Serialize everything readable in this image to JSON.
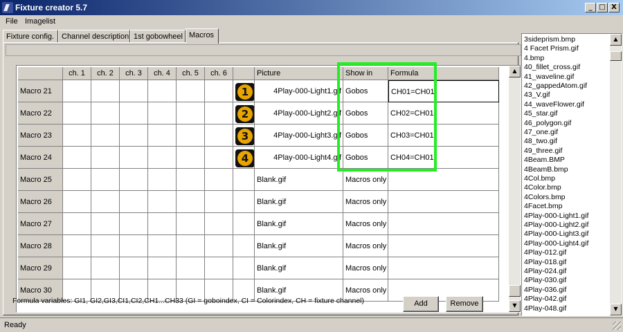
{
  "window": {
    "title": "Fixture creator 5.7",
    "min": "_",
    "max": "□",
    "close": "X"
  },
  "menu": [
    "File",
    "Imagelist"
  ],
  "tabs": [
    "Fixture config.",
    "Channel description",
    "1st gobowheel",
    "Macros"
  ],
  "active_tab": "Macros",
  "grid": {
    "headers": [
      "",
      "ch. 1",
      "ch. 2",
      "ch. 3",
      "ch. 4",
      "ch. 5",
      "ch. 6",
      "",
      "Picture",
      "Show in",
      "Formula"
    ],
    "rows": [
      {
        "name": "Macro 21",
        "badge": "1",
        "picture": "4Play-000-Light1.gif",
        "show_in": "Gobos",
        "formula": "CH01=CH01"
      },
      {
        "name": "Macro 22",
        "badge": "2",
        "picture": "4Play-000-Light2.gif",
        "show_in": "Gobos",
        "formula": "CH02=CH01"
      },
      {
        "name": "Macro 23",
        "badge": "3",
        "picture": "4Play-000-Light3.gif",
        "show_in": "Gobos",
        "formula": "CH03=CH01"
      },
      {
        "name": "Macro 24",
        "badge": "4",
        "picture": "4Play-000-Light4.gif",
        "show_in": "Gobos",
        "formula": "CH04=CH01"
      },
      {
        "name": "Macro 25",
        "badge": "",
        "picture": "Blank.gif",
        "show_in": "Macros only",
        "formula": ""
      },
      {
        "name": "Macro 26",
        "badge": "",
        "picture": "Blank.gif",
        "show_in": "Macros only",
        "formula": ""
      },
      {
        "name": "Macro 27",
        "badge": "",
        "picture": "Blank.gif",
        "show_in": "Macros only",
        "formula": ""
      },
      {
        "name": "Macro 28",
        "badge": "",
        "picture": "Blank.gif",
        "show_in": "Macros only",
        "formula": ""
      },
      {
        "name": "Macro 29",
        "badge": "",
        "picture": "Blank.gif",
        "show_in": "Macros only",
        "formula": ""
      },
      {
        "name": "Macro 30",
        "badge": "",
        "picture": "Blank.gif",
        "show_in": "Macros only",
        "formula": ""
      }
    ],
    "scroll_up": "▲",
    "scroll_down": "▼"
  },
  "formula_help": "Formula variables: GI1, GI2,GI3,CI1,CI2,CH1...CH33 (GI = goboindex, CI = Colorindex, CH = fixture channel)",
  "buttons": {
    "add": "Add",
    "remove": "Remove"
  },
  "imagelist": [
    "3sideprism.bmp",
    "4 Facet Prism.gif",
    "4.bmp",
    "40_fillet_cross.gif",
    "41_waveline.gif",
    "42_gappedAtom.gif",
    "43_V.gif",
    "44_waveFlower.gif",
    "45_star.gif",
    "46_polygon.gif",
    "47_one.gif",
    "48_two.gif",
    "49_three.gif",
    "4Beam.BMP",
    "4BeamB.bmp",
    "4Col.bmp",
    "4Color.bmp",
    "4Colors.bmp",
    "4Facet.bmp",
    "4Play-000-Light1.gif",
    "4Play-000-Light2.gif",
    "4Play-000-Light3.gif",
    "4Play-000-Light4.gif",
    "4Play-012.gif",
    "4Play-018.gif",
    "4Play-024.gif",
    "4Play-030.gif",
    "4Play-036.gif",
    "4Play-042.gif",
    "4Play-048.gif"
  ],
  "status": "Ready",
  "colors": {
    "highlight": "#22ee22",
    "badge": "#e8a400",
    "titlebar": "#0a246a"
  }
}
